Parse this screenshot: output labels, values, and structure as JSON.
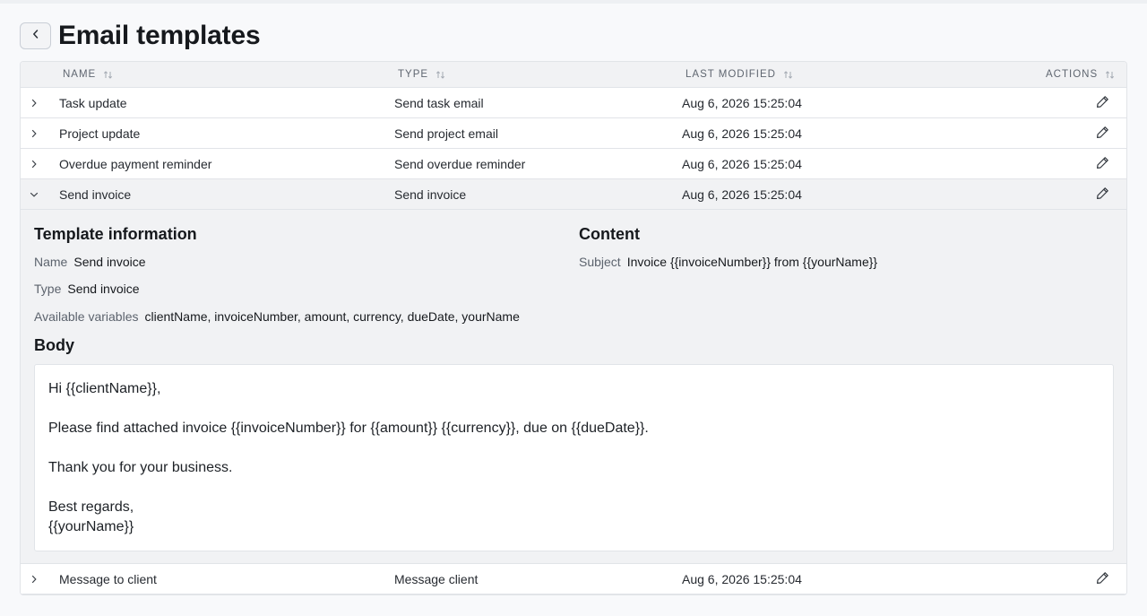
{
  "page": {
    "title": "Email templates",
    "back_icon": "chevron-left-icon"
  },
  "table": {
    "columns": [
      {
        "label": "NAME"
      },
      {
        "label": "TYPE"
      },
      {
        "label": "LAST MODIFIED"
      },
      {
        "label": "ACTIONS"
      }
    ],
    "rows": [
      {
        "name": "Task update",
        "type": "Send task email",
        "modified": "Aug 6, 2026 15:25:04",
        "expanded": false
      },
      {
        "name": "Project update",
        "type": "Send project email",
        "modified": "Aug 6, 2026 15:25:04",
        "expanded": false
      },
      {
        "name": "Overdue payment reminder",
        "type": "Send overdue reminder",
        "modified": "Aug 6, 2026 15:25:04",
        "expanded": false
      },
      {
        "name": "Send invoice",
        "type": "Send invoice",
        "modified": "Aug 6, 2026 15:25:04",
        "expanded": true
      },
      {
        "name": "Message to client",
        "type": "Message client",
        "modified": "Aug 6, 2026 15:25:04",
        "expanded": false
      }
    ]
  },
  "detail": {
    "template_info_title": "Template information",
    "name_label": "Name",
    "name_value": "Send invoice",
    "type_label": "Type",
    "type_value": "Send invoice",
    "variables_label": "Available variables",
    "variables_value": "clientName, invoiceNumber, amount, currency, dueDate, yourName",
    "content_title": "Content",
    "subject_label": "Subject",
    "subject_value": "Invoice {{invoiceNumber}} from {{yourName}}",
    "body_title": "Body",
    "body": {
      "line1": "Hi {{clientName}},",
      "line2": "Please find attached invoice {{invoiceNumber}} for {{amount}} {{currency}}, due on {{dueDate}}.",
      "line3": "Thank you for your business.",
      "line4": "Best regards,",
      "line5": "{{yourName}}"
    }
  },
  "colors": {
    "page_bg": "#f8f9fb",
    "header_bg": "#f1f2f4",
    "border": "#e1e4e8",
    "text": "#1f2328",
    "muted": "#5f6670"
  }
}
